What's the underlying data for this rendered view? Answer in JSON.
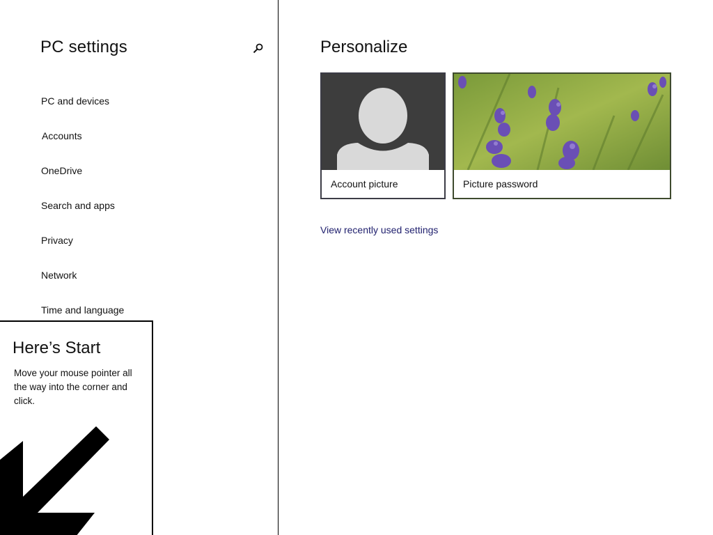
{
  "left_pane": {
    "title": "PC settings",
    "search_icon": "search-icon",
    "nav_items": [
      {
        "label": "PC and devices"
      },
      {
        "label": "Accounts"
      },
      {
        "label": "OneDrive"
      },
      {
        "label": "Search and apps"
      },
      {
        "label": "Privacy"
      },
      {
        "label": "Network"
      },
      {
        "label": "Time and language"
      }
    ]
  },
  "tip": {
    "title": "Here’s Start",
    "body": "Move your mouse pointer all the way into the corner and click.",
    "arrow_icon": "arrow-down-left-icon"
  },
  "main": {
    "title": "Personalize",
    "tiles": [
      {
        "label": "Account picture",
        "icon": "user-avatar-icon"
      },
      {
        "label": "Picture password",
        "icon": "lavender-photo"
      }
    ],
    "recent_link": "View recently used settings"
  },
  "colors": {
    "link": "#20206e",
    "account_tile_bg": "#3d3d3d",
    "avatar": "#d9d9d9"
  }
}
